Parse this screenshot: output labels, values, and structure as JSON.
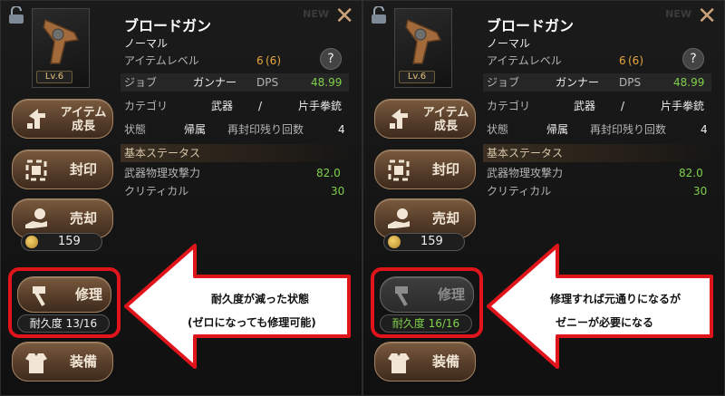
{
  "colors": {
    "accent": "#e0141b",
    "stat_green": "#7fd14a",
    "level_orange": "#e8a640",
    "button_brown": "#6a4c34"
  },
  "panels": [
    {
      "item_name": "ブロードガン",
      "rarity": "ノーマル",
      "lv_badge": "Lv.6",
      "item_level_label": "アイテムレベル",
      "item_level_value": "6",
      "item_level_paren": "(6)",
      "help_icon": "?",
      "job_label": "ジョブ",
      "job_value": "ガンナー",
      "dps_label": "DPS",
      "dps_value": "48.99",
      "category_label": "カテゴリ",
      "category_value": "武器",
      "category_sep": "/",
      "category_sub": "片手拳銃",
      "state_label": "状態",
      "state_value": "帰属",
      "reseal_label": "再封印残り回数",
      "reseal_value": "4",
      "section_title": "基本ステータス",
      "stat1_label": "武器物理攻撃力",
      "stat1_value": "82.0",
      "stat2_label": "クリティカル",
      "stat2_value": "30",
      "grow_label_1": "アイテム",
      "grow_label_2": "成長",
      "seal_label": "封印",
      "sell_label": "売却",
      "sell_price": "159",
      "repair_label": "修理",
      "durability": "耐久度 13/16",
      "equip_label": "装備",
      "new_tag": "NEW",
      "callout_line1": "耐久度が減った状態",
      "callout_line2": "(ゼロになっても修理可能)"
    },
    {
      "item_name": "ブロードガン",
      "rarity": "ノーマル",
      "lv_badge": "Lv.6",
      "item_level_label": "アイテムレベル",
      "item_level_value": "6",
      "item_level_paren": "(6)",
      "help_icon": "?",
      "job_label": "ジョブ",
      "job_value": "ガンナー",
      "dps_label": "DPS",
      "dps_value": "48.99",
      "category_label": "カテゴリ",
      "category_value": "武器",
      "category_sep": "/",
      "category_sub": "片手拳銃",
      "state_label": "状態",
      "state_value": "帰属",
      "reseal_label": "再封印残り回数",
      "reseal_value": "4",
      "section_title": "基本ステータス",
      "stat1_label": "武器物理攻撃力",
      "stat1_value": "82.0",
      "stat2_label": "クリティカル",
      "stat2_value": "30",
      "grow_label_1": "アイテム",
      "grow_label_2": "成長",
      "seal_label": "封印",
      "sell_label": "売却",
      "sell_price": "159",
      "repair_label": "修理",
      "durability": "耐久度 16/16",
      "equip_label": "装備",
      "new_tag": "NEW",
      "callout_line1": "修理すれば元通りになるが",
      "callout_line2": "ゼニーが必要になる"
    }
  ]
}
